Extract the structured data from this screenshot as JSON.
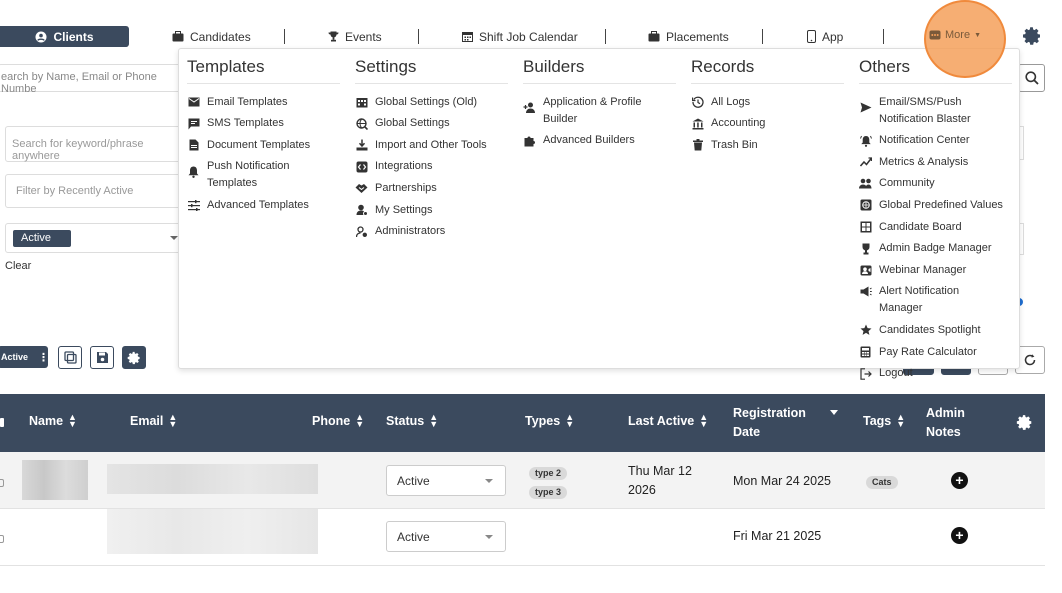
{
  "nav": {
    "clients": "Clients",
    "candidates": "Candidates",
    "events": "Events",
    "shift_job_calendar": "Shift Job Calendar",
    "placements": "Placements",
    "app": "App",
    "more": "More"
  },
  "filters": {
    "main_search_placeholder": "earch by Name, Email or Phone Numbe",
    "keyword_placeholder": "Search for keyword/phrase anywhere",
    "recent_placeholder": "Filter by Recently Active",
    "status_chip": "Active",
    "clear": "Clear"
  },
  "toolbar": {
    "active_label": "Active"
  },
  "menu": {
    "templates": {
      "title": "Templates",
      "items": [
        "Email Templates",
        "SMS Templates",
        "Document Templates",
        "Push Notification Templates",
        "Advanced Templates"
      ]
    },
    "settings": {
      "title": "Settings",
      "items": [
        "Global Settings (Old)",
        "Global Settings",
        "Import and Other Tools",
        "Integrations",
        "Partnerships",
        "My Settings",
        "Administrators"
      ]
    },
    "builders": {
      "title": "Builders",
      "items": [
        "Application & Profile Builder",
        "Advanced Builders"
      ]
    },
    "records": {
      "title": "Records",
      "items": [
        "All Logs",
        "Accounting",
        "Trash Bin"
      ]
    },
    "others": {
      "title": "Others",
      "items": [
        "Email/SMS/Push Notification Blaster",
        "Notification Center",
        "Metrics & Analysis",
        "Community",
        "Global Predefined Values",
        "Candidate Board",
        "Admin Badge Manager",
        "Webinar Manager",
        "Alert Notification Manager",
        "Candidates Spotlight",
        "Pay Rate Calculator",
        "Logout"
      ]
    }
  },
  "table": {
    "headers": {
      "name": "Name",
      "email": "Email",
      "phone": "Phone",
      "status": "Status",
      "types": "Types",
      "last_active": "Last Active",
      "registration_date_l1": "Registration",
      "registration_date_l2": "Date",
      "tags": "Tags",
      "admin_notes_l1": "Admin",
      "admin_notes_l2": "Notes"
    },
    "rows": [
      {
        "status": "Active",
        "types": [
          "type 2",
          "type 3"
        ],
        "last_active_l1": "Thu Mar 12",
        "last_active_l2": "2026",
        "registration_date": "Mon Mar 24 2025",
        "tag": "Cats"
      },
      {
        "status": "Active",
        "types": [],
        "last_active_l1": "",
        "last_active_l2": "",
        "registration_date": "Fri Mar 21 2025",
        "tag": ""
      }
    ]
  },
  "colors": {
    "navy": "#3b4a5e",
    "highlight": "#f5a05a"
  },
  "icons": [
    "user-circle-icon",
    "briefcase-icon",
    "trophy-icon",
    "calendar-icon",
    "phone-icon",
    "dots-icon",
    "gear-icon",
    "search-icon",
    "refresh-icon",
    "save-icon",
    "copy-icon",
    "plus-circle-icon"
  ]
}
